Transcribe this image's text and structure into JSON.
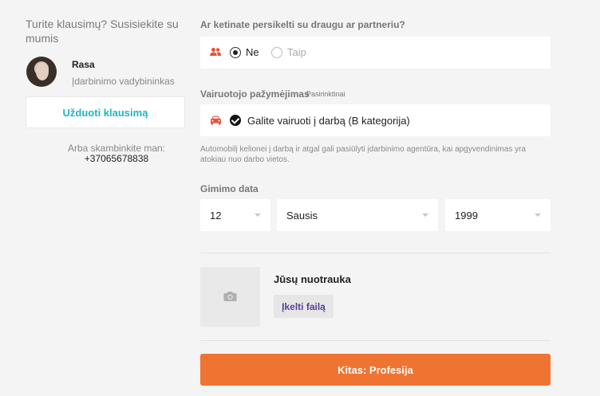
{
  "sidebar": {
    "title": "Turite klausimų? Susisiekite su mumis",
    "agent_name": "Rasa",
    "agent_role": "Įdarbinimo vadybininkas",
    "ask_button": "Užduoti klausimą",
    "call_label": "Arba skambinkite man:",
    "phone": "+37065678838"
  },
  "partner": {
    "label": "Ar ketinate persikelti su draugu ar partneriu?",
    "options": [
      {
        "label": "Ne",
        "selected": true
      },
      {
        "label": "Taip",
        "selected": false
      }
    ],
    "icon": "people-icon"
  },
  "license": {
    "label": "Vairuotojo pažymėjimas",
    "optional": "Pasirinktinai",
    "option_text": "Galite vairuoti į darbą (B kategorija)",
    "checked": true,
    "note": "Automobilį kelionei į darbą ir atgal gali pasiūlyti įdarbinimo agentūra, kai apgyvendinimas yra atokiau nuo darbo vietos.",
    "icon": "car-icon"
  },
  "dob": {
    "label": "Gimimo data",
    "day": "12",
    "month": "Sausis",
    "year": "1999"
  },
  "photo": {
    "title": "Jūsų nuotrauka",
    "upload_label": "Įkelti failą",
    "icon": "camera-icon"
  },
  "next_button": "Kitas: Profesija",
  "colors": {
    "accent_orange": "#f07431",
    "teal": "#1fb6c1",
    "purple": "#5a3d9a",
    "icon_red": "#e8513a"
  }
}
